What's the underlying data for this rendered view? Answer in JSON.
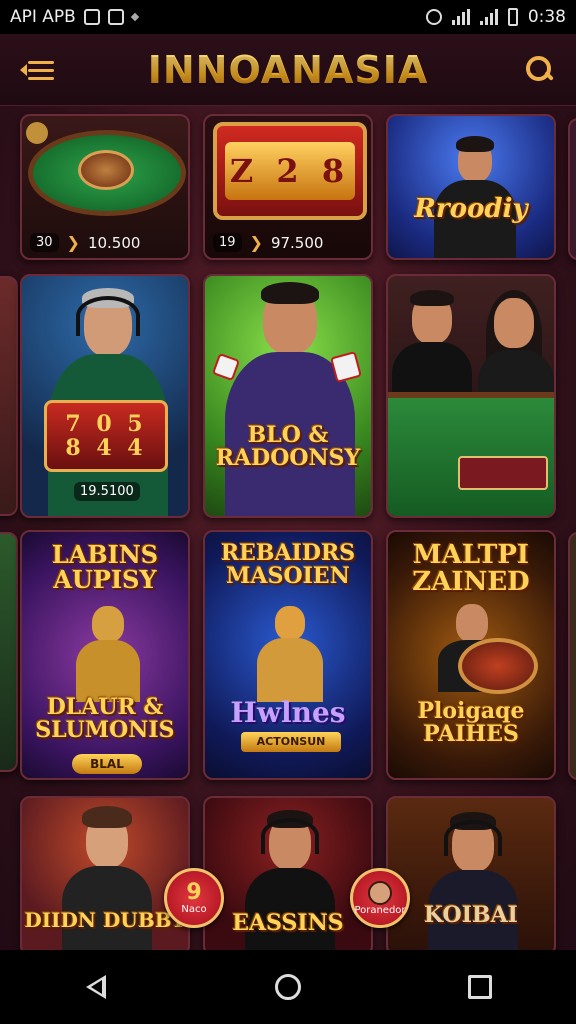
{
  "status_bar": {
    "carrier": "API APB",
    "time": "0:38"
  },
  "header": {
    "title": "INNOANASIA"
  },
  "tiles": [
    {
      "title": "",
      "price_badge": "30",
      "price": "10.500"
    },
    {
      "title": "",
      "reel_text": "Z 2 8",
      "price_badge": "19",
      "price": "97.500"
    },
    {
      "title": "Rroodiy"
    },
    {
      "title": "",
      "reel_text": "7 0 5",
      "reel_text2": "8 4 4",
      "price": "19.5100"
    },
    {
      "title": "BLO & RADOONSY"
    },
    {
      "title": ""
    },
    {
      "title_top": "LABINS AUPISY",
      "title_bottom": "DLAUR & SLUMONIS",
      "ribbon": "BLAL"
    },
    {
      "title_top": "REBAIDRS MASOIEN",
      "title_bottom": "Hwlnes",
      "ribbon": "ACTONSUN"
    },
    {
      "title_top": "MALTPI ZAINED",
      "title_bottom": "Ploigaqe PAIHES"
    },
    {
      "title_bottom": "DIIDN DUBBY"
    },
    {
      "title_bottom": "EASSINS"
    },
    {
      "title_bottom": "KOIBAI"
    }
  ],
  "floating": [
    {
      "glyph": "9",
      "label": "Naco"
    },
    {
      "label": "Poranedor"
    }
  ],
  "colors": {
    "accent": "#f0b04a",
    "background": "#3a1420"
  }
}
